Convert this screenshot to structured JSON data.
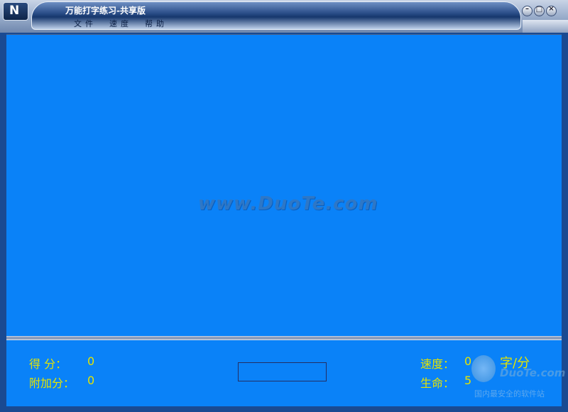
{
  "window": {
    "title": "万能打字练习-共享版",
    "logo_text": "N"
  },
  "menu": [
    "文件",
    "速度",
    "帮助"
  ],
  "play_area": {
    "watermark": "www.DuoTe.com",
    "background": "#0a82f8"
  },
  "status": {
    "score_label": "得  分：",
    "score_value": "0",
    "bonus_label": "附加分：",
    "bonus_value": "0",
    "speed_label": "速度：",
    "speed_value": "0",
    "speed_unit": "字/分",
    "lives_label": "生命：",
    "lives_value": "5",
    "label_color": "#e5e400"
  },
  "stamp": {
    "line1": "DuoTe.com",
    "line2": "国内最安全的软件站"
  }
}
